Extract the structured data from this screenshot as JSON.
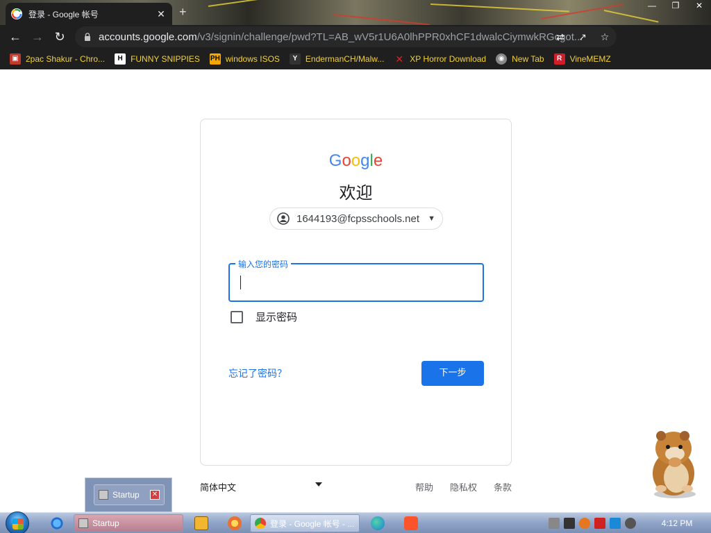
{
  "browser": {
    "tab_title": "登录 - Google 帐号",
    "url_host": "accounts.google.com",
    "url_path": "/v3/signin/challenge/pwd?TL=AB_wV5r1U6A0lhPPR0xhCF1dwalcCiymwkRGcgot...",
    "bookmarks": [
      {
        "label": "2pac Shakur - Chro...",
        "icon": "gift-icon",
        "color": "#c0392b"
      },
      {
        "label": "FUNNY SNIPPIES",
        "icon": "h-icon",
        "color": "#222222"
      },
      {
        "label": "windows ISOS",
        "icon": "ph-icon",
        "color": "#f7a800"
      },
      {
        "label": "EndermanCH/Malw...",
        "icon": "yp-icon",
        "color": "#333333"
      },
      {
        "label": "XP Horror Download",
        "icon": "x-icon",
        "color": "#e02020"
      },
      {
        "label": "New Tab",
        "icon": "globe-icon",
        "color": "#888888"
      },
      {
        "label": "VineMEMZ",
        "icon": "r-icon",
        "color": "#d01d2a"
      }
    ]
  },
  "signin": {
    "logo_letters": [
      "G",
      "o",
      "o",
      "g",
      "l",
      "e"
    ],
    "logo_colors": [
      "#4285F4",
      "#EA4335",
      "#FBBC05",
      "#4285F4",
      "#34A853",
      "#EA4335"
    ],
    "welcome": "欢迎",
    "account_email": "1644193@fcpsschools.net",
    "password_label": "输入您的密码",
    "password_value": "",
    "show_password_label": "显示密码",
    "forgot_label": "忘记了密码？",
    "next_label": "下一步"
  },
  "footer": {
    "language": "简体中文",
    "help": "帮助",
    "privacy": "隐私权",
    "terms": "条款"
  },
  "popup": {
    "item_label": "Startup"
  },
  "taskbar": {
    "startup_label": "Startup",
    "chrome_label": "登录 - Google 帐号 - ...",
    "clock": "4:12 PM"
  }
}
